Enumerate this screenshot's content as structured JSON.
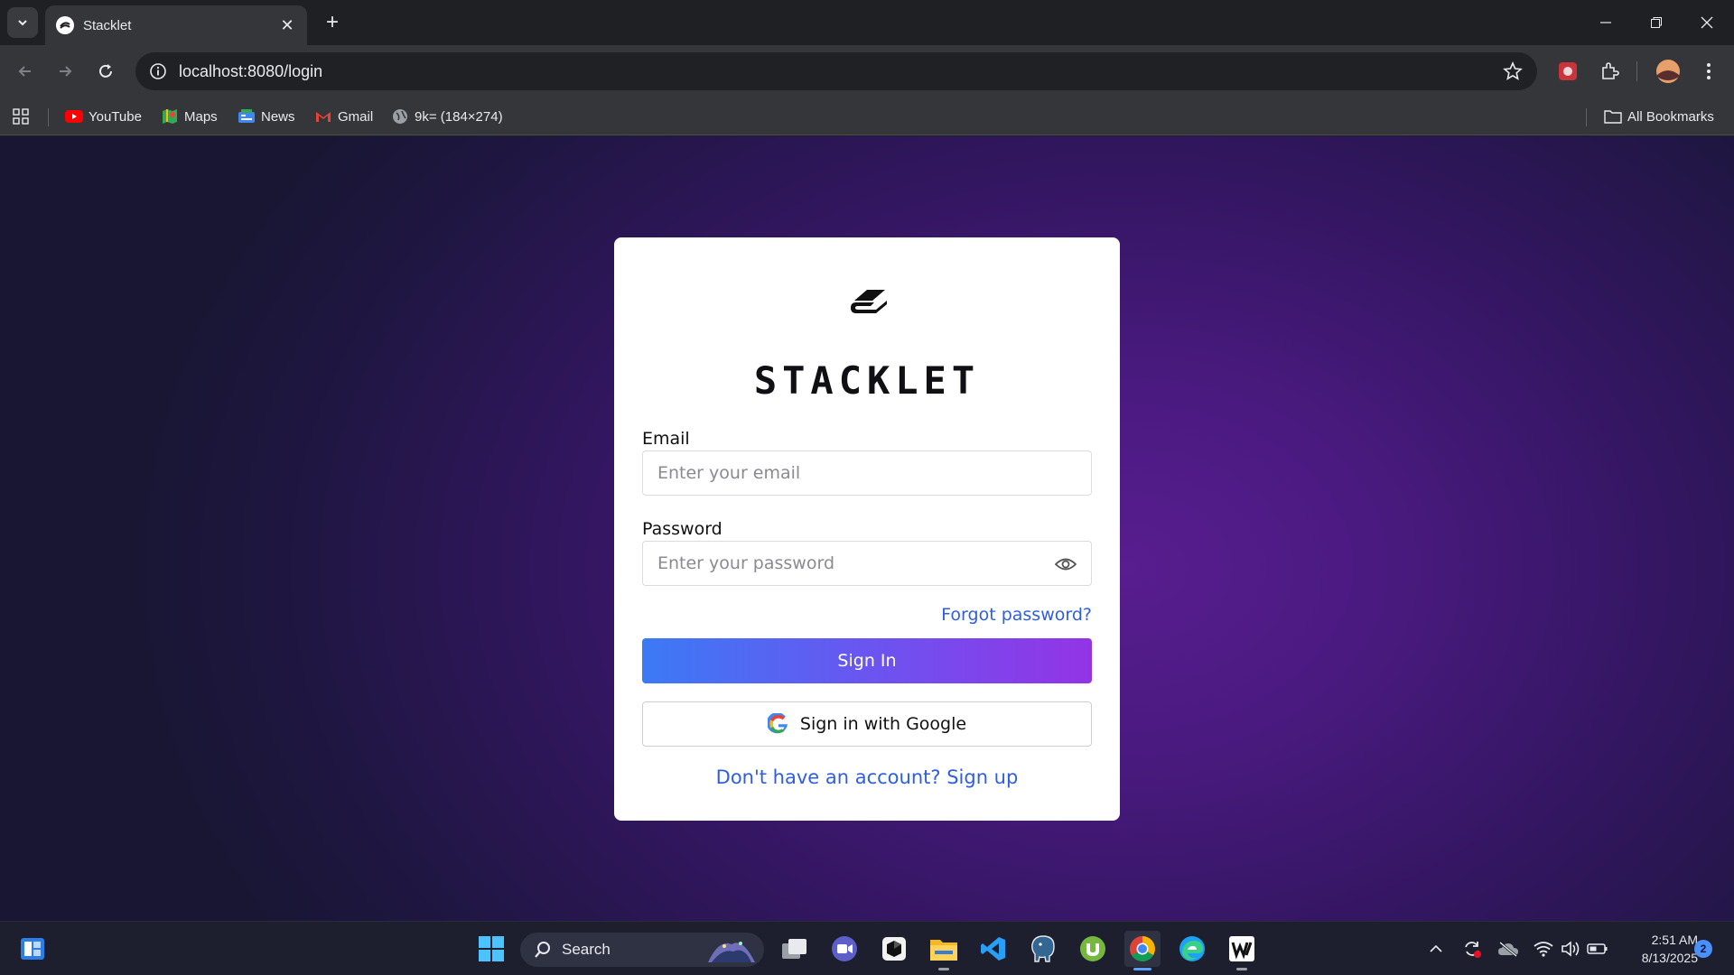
{
  "browser": {
    "tab_title": "Stacklet",
    "url": "localhost:8080/login",
    "bookmarks": [
      {
        "label": "YouTube",
        "icon": "youtube-icon"
      },
      {
        "label": "Maps",
        "icon": "maps-icon"
      },
      {
        "label": "News",
        "icon": "news-icon"
      },
      {
        "label": "Gmail",
        "icon": "gmail-icon"
      },
      {
        "label": "9k= (184×274)",
        "icon": "globe-icon"
      }
    ],
    "all_bookmarks_label": "All Bookmarks"
  },
  "login": {
    "brand": "STACKLET",
    "email_label": "Email",
    "email_placeholder": "Enter your email",
    "password_label": "Password",
    "password_placeholder": "Enter your password",
    "forgot_label": "Forgot password?",
    "signin_label": "Sign In",
    "google_label": "Sign in with Google",
    "signup_label": "Don't have an account? Sign up"
  },
  "taskbar": {
    "search_label": "Search",
    "time": "2:51 AM",
    "date": "8/13/2025",
    "notification_count": "2"
  },
  "colors": {
    "link": "#2f5fe0",
    "button_gradient_start": "#3b7af5",
    "button_gradient_end": "#9334e6",
    "background_purple": "#581d8f"
  }
}
